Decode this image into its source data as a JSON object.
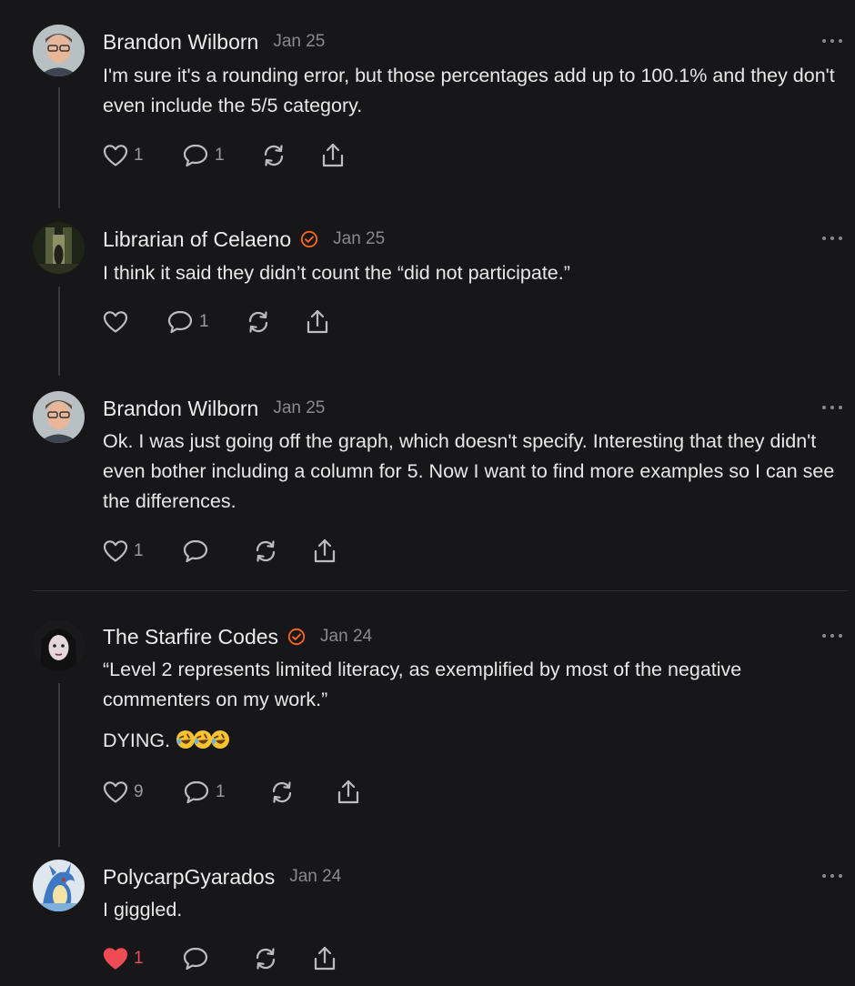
{
  "comments": [
    {
      "author": "Brandon Wilborn",
      "date": "Jan 25",
      "verified": false,
      "avatar": "avatar-brandon",
      "text": [
        "I'm sure it's a rounding error, but those percentages add up to 100.1% and they don't even include the 5/5 category."
      ],
      "likes": "1",
      "replies": "1",
      "liked": false
    },
    {
      "author": "Librarian of Celaeno",
      "date": "Jan 25",
      "verified": true,
      "avatar": "avatar-librarian",
      "text": [
        "I think it said they didn’t count the “did not participate.”"
      ],
      "likes": "",
      "replies": "1",
      "liked": false
    },
    {
      "author": "Brandon Wilborn",
      "date": "Jan 25",
      "verified": false,
      "avatar": "avatar-brandon",
      "text": [
        "Ok. I was just going off the graph, which doesn't specify. Interesting that they didn't even bother including a column for 5. Now I want to find more examples so I can see the differences."
      ],
      "likes": "1",
      "replies": "",
      "liked": false
    },
    {
      "author": "The Starfire Codes",
      "date": "Jan 24",
      "verified": true,
      "avatar": "avatar-starfire",
      "text": [
        "“Level 2 represents limited literacy, as exemplified by most of the negative commenters on my work.”",
        "DYING."
      ],
      "emoji": [
        "rolling-on-floor-laughing-emoji",
        "rolling-on-floor-laughing-emoji",
        "rolling-on-floor-laughing-emoji"
      ],
      "likes": "9",
      "replies": "1",
      "liked": false
    },
    {
      "author": "PolycarpGyarados",
      "date": "Jan 24",
      "verified": false,
      "avatar": "avatar-gyarados",
      "text": [
        "I giggled."
      ],
      "likes": "1",
      "replies": "",
      "liked": true
    }
  ],
  "icons": {
    "like": "heart-icon",
    "reply": "speech-bubble-icon",
    "restack": "restack-icon",
    "share": "share-icon",
    "more": "more-options-icon",
    "verified": "verified-badge-icon"
  },
  "colors": {
    "background": "#171719",
    "accent": "#ff6719",
    "liked": "#ee4b55",
    "muted": "#8a8a8e"
  }
}
